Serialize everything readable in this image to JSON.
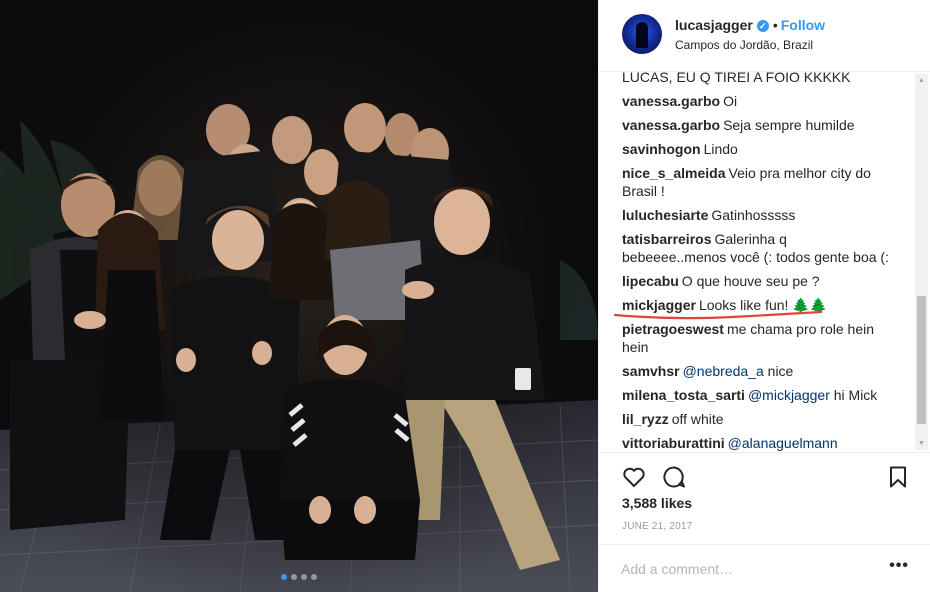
{
  "post": {
    "username": "lucasjagger",
    "follow_label": "Follow",
    "separator": "•",
    "location": "Campos do Jordão, Brazil",
    "verified_glyph": "✓"
  },
  "comments": [
    {
      "user": "",
      "text": "LUCAS, EU Q TIREI A FOIO KKKKK"
    },
    {
      "user": "vanessa.garbo",
      "text": "Oi"
    },
    {
      "user": "vanessa.garbo",
      "text": "Seja sempre humilde"
    },
    {
      "user": "savinhogon",
      "text": "Lindo"
    },
    {
      "user": "nice_s_almeida",
      "text": "Veio pra melhor city do Brasil !"
    },
    {
      "user": "luluchesiarte",
      "text": "Gatinhosssss"
    },
    {
      "user": "tatisbarreiros",
      "text": "Galerinha q bebeeee..menos você (: todos gente boa (:"
    },
    {
      "user": "lipecabu",
      "text": "O que houve seu pe ?"
    },
    {
      "user": "mickjagger",
      "text": "Looks like fun! 🌲🌲"
    },
    {
      "user": "pietragoeswest",
      "text": "me chama pro role hein hein"
    },
    {
      "user": "samvhsr",
      "text": "",
      "mention": "@nebreda_a",
      "after": " nice"
    },
    {
      "user": "milena_tosta_sarti",
      "text": "",
      "mention": "@mickjagger",
      "after": " hi Mick"
    },
    {
      "user": "lil_ryzz",
      "text": "off white"
    },
    {
      "user": "vittoriaburattini",
      "text": "",
      "mention": "@alanaguelmann",
      "after": ""
    }
  ],
  "likes": "3,588 likes",
  "date": "JUNE 21, 2017",
  "comment_placeholder": "Add a comment…",
  "more_glyph": "•••",
  "icons": {
    "like": "heart-outline-icon",
    "comment": "speech-bubble-icon",
    "save": "bookmark-icon"
  },
  "colors": {
    "accent": "#3897f0",
    "mention": "#003569",
    "highlight_underline": "#e0443c"
  }
}
